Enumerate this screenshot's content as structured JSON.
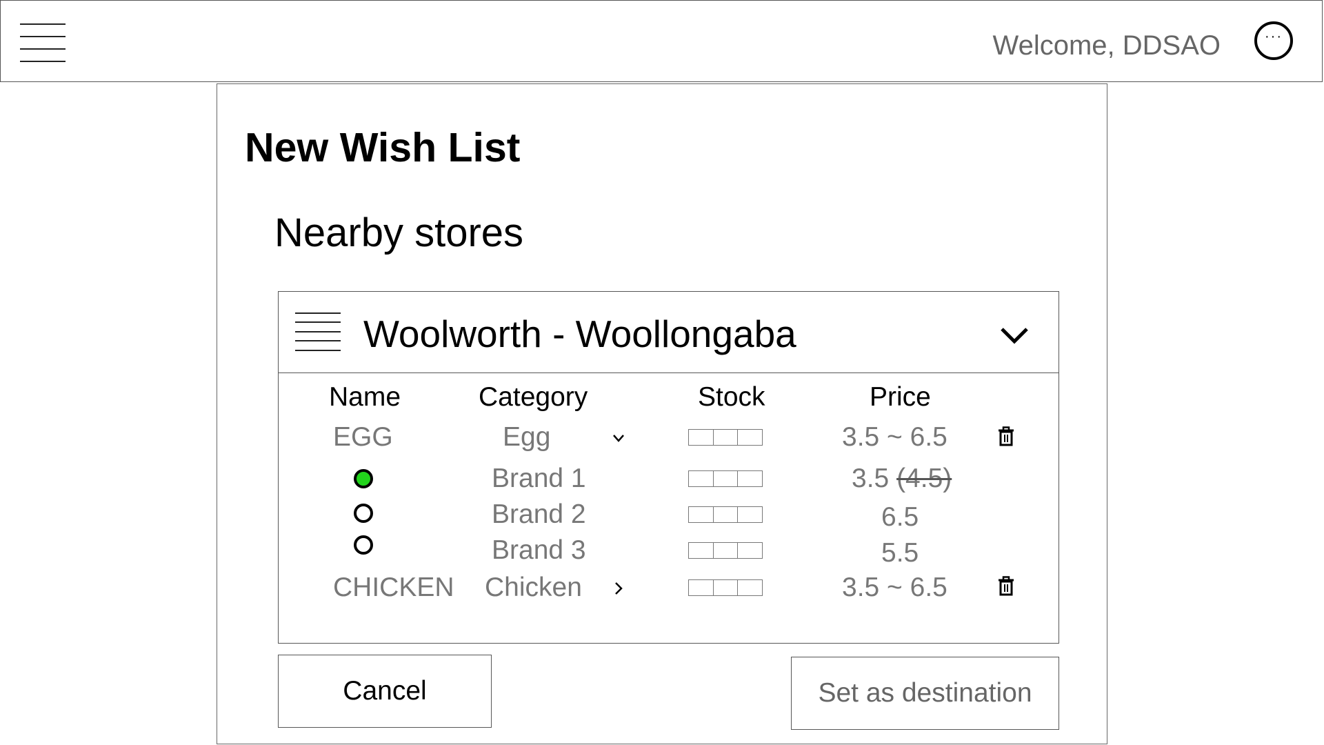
{
  "header": {
    "welcome_text": "Welcome, DDSAO",
    "menu_icon": "hamburger-menu-icon",
    "more_icon": "more-options-icon",
    "more_glyph": "···"
  },
  "page": {
    "title": "New Wish List",
    "section_title": "Nearby stores"
  },
  "store": {
    "name": "Woolworth - Woollongaba",
    "expanded": true
  },
  "table": {
    "columns": [
      "Name",
      "Category",
      "Stock",
      "Price"
    ],
    "items": [
      {
        "name": "EGG",
        "category": "Egg",
        "expanded": true,
        "price": "3.5 ~ 6.5",
        "brands": [
          {
            "label": "Brand 1",
            "selected": true,
            "price": "3.5",
            "original_price": "(4.5)"
          },
          {
            "label": "Brand 2",
            "selected": false,
            "price": "6.5"
          },
          {
            "label": "Brand 3",
            "selected": false,
            "price": "5.5"
          }
        ]
      },
      {
        "name": "CHICKEN",
        "category": "Chicken",
        "expanded": false,
        "price": "3.5 ~ 6.5"
      }
    ]
  },
  "actions": {
    "cancel_label": "Cancel",
    "destination_label": "Set as destination"
  },
  "colors": {
    "selected_radio": "#22d41c",
    "muted_text": "#777777"
  }
}
